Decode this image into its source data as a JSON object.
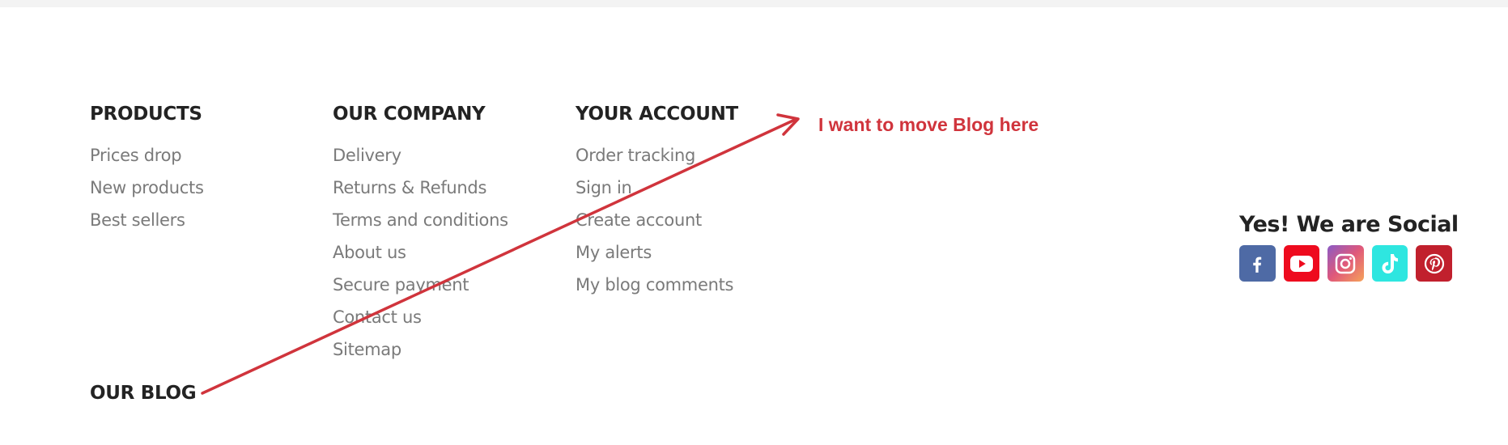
{
  "footer": {
    "products": {
      "title": "PRODUCTS",
      "links": [
        "Prices drop",
        "New products",
        "Best sellers"
      ]
    },
    "company": {
      "title": "OUR COMPANY",
      "links": [
        "Delivery",
        "Returns & Refunds",
        "Terms and conditions",
        "About us",
        "Secure payment",
        "Contact us",
        "Sitemap"
      ]
    },
    "account": {
      "title": "YOUR ACCOUNT",
      "links": [
        "Order tracking",
        "Sign in",
        "Create account",
        "My alerts",
        "My blog comments"
      ]
    },
    "blog": {
      "title": "OUR BLOG"
    },
    "social": {
      "title": "Yes! We are Social",
      "icons": [
        {
          "name": "facebook-icon",
          "color": "#3b5998"
        },
        {
          "name": "youtube-icon",
          "color": "#ff0000"
        },
        {
          "name": "instagram-icon",
          "color": "#e1306c"
        },
        {
          "name": "tiktok-icon",
          "color": "#25f4ee"
        },
        {
          "name": "pinterest-icon",
          "color": "#bd081c"
        }
      ]
    }
  },
  "annotation": {
    "text": "I want to move Blog here",
    "color": "#d0343c"
  }
}
